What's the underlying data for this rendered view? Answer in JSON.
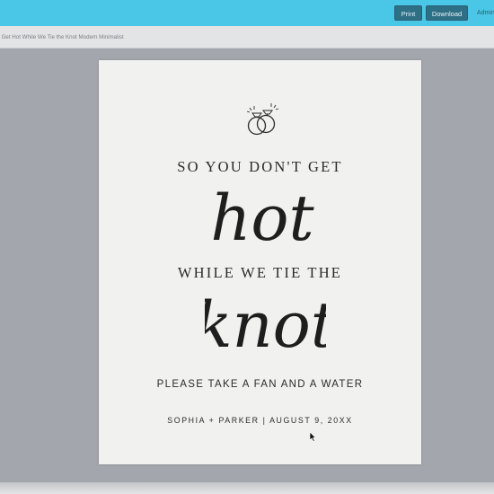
{
  "toolbar": {
    "print_label": "Print",
    "download_label": "Download",
    "admin_label": "Admin"
  },
  "document": {
    "title": "'t Get Hot While We Tie the Knot Modern Minimalist"
  },
  "sign": {
    "line1": "SO YOU DON'T GET",
    "script1": "hot",
    "line2": "WHILE WE TIE THE",
    "script2": "knot",
    "line3": "PLEASE TAKE A FAN AND A WATER",
    "line4": "SOPHIA + PARKER | AUGUST 9, 20XX"
  },
  "icons": {
    "rings": "wedding-rings-icon",
    "cursor": "mouse-cursor-icon"
  },
  "colors": {
    "topbar": "#4ac6e6",
    "button": "#2f6f86",
    "workspace": "#a3a7ad",
    "paper": "#f1f1f0",
    "ink": "#2b2b2b"
  }
}
